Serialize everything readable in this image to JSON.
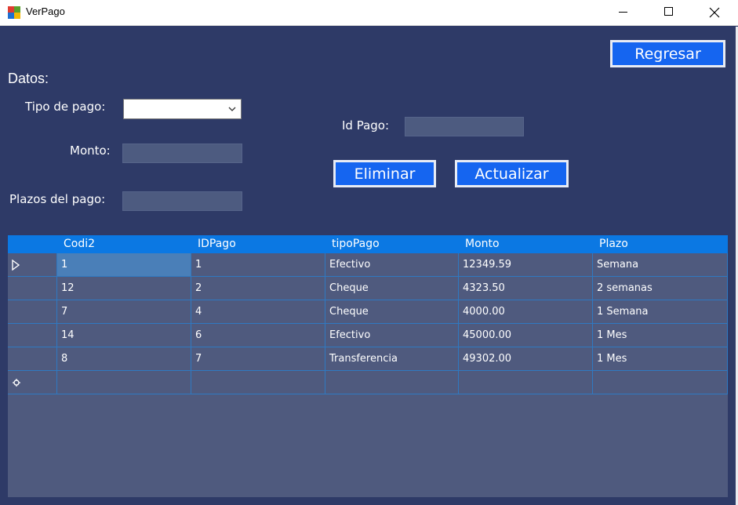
{
  "window": {
    "title": "VerPago"
  },
  "form": {
    "heading": "Datos:",
    "tipo_label": "Tipo de pago:",
    "tipo_value": "",
    "monto_label": "Monto:",
    "monto_value": "",
    "plazos_label": "Plazos del pago:",
    "plazos_value": "",
    "idpago_label": "Id Pago:",
    "idpago_value": ""
  },
  "buttons": {
    "regresar": "Regresar",
    "eliminar": "Eliminar",
    "actualizar": "Actualizar"
  },
  "grid": {
    "columns": [
      "Codi2",
      "IDPago",
      "tipoPago",
      "Monto",
      "Plazo"
    ],
    "rows": [
      [
        "1",
        "1",
        "Efectivo",
        "12349.59",
        "Semana"
      ],
      [
        "12",
        "2",
        "Cheque",
        "4323.50",
        "2 semanas"
      ],
      [
        "7",
        "4",
        "Cheque",
        "4000.00",
        "1 Semana"
      ],
      [
        "14",
        "6",
        "Efectivo",
        "45000.00",
        "1 Mes"
      ],
      [
        "8",
        "7",
        "Transferencia",
        "49302.00",
        "1 Mes"
      ]
    ]
  },
  "colors": {
    "background": "#2e3a67",
    "header": "#0b78e3",
    "button": "#1565f0",
    "grid_bg": "#4f5a7e"
  }
}
